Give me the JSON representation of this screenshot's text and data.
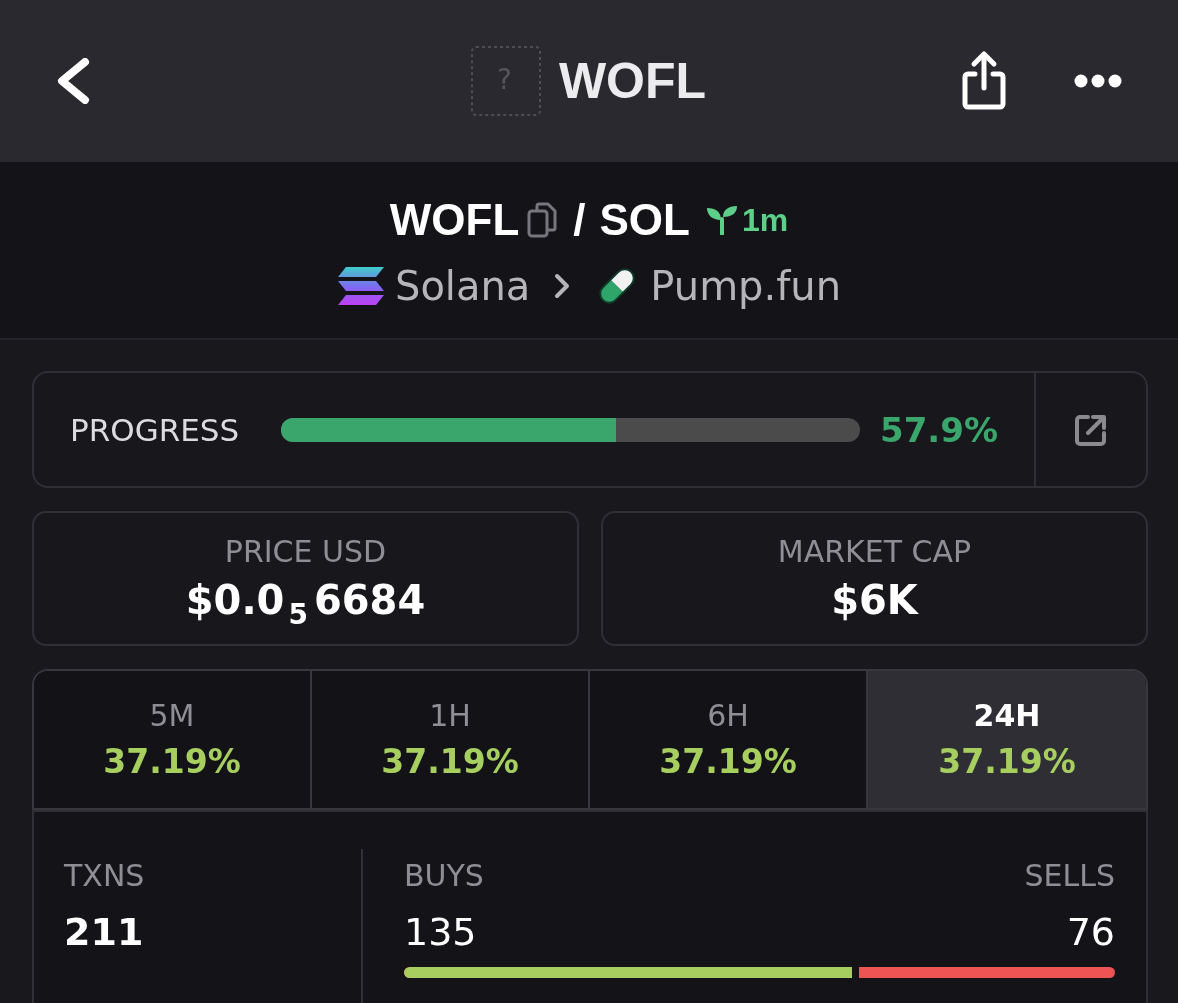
{
  "top_bar": {
    "title": "WOFL",
    "token_placeholder": "?"
  },
  "pair": {
    "base": "WOFL",
    "separator": "/",
    "quote": "SOL",
    "age": "1m",
    "chain": "Solana",
    "dex": "Pump.fun"
  },
  "progress": {
    "label": "PROGRESS",
    "level": 0.579,
    "reading": "57.9%"
  },
  "stats": [
    {
      "label": "PRICE USD",
      "value": "$0.0$_{5}$6684"
    },
    {
      "label": "MARKET CAP",
      "value": "$6K"
    }
  ],
  "timeframes": [
    {
      "label": "5M",
      "change": "37.19%",
      "selected": false
    },
    {
      "label": "1H",
      "change": "37.19%",
      "selected": false
    },
    {
      "label": "6H",
      "change": "37.19%",
      "selected": false
    },
    {
      "label": "24H",
      "change": "37.19%",
      "selected": true
    }
  ],
  "transactions": {
    "txns_label": "TXNS",
    "txns": "211",
    "buys_label": "BUYS",
    "buys": "135",
    "sells_label": "SELLS",
    "sells": "76",
    "level": 0.64
  }
}
